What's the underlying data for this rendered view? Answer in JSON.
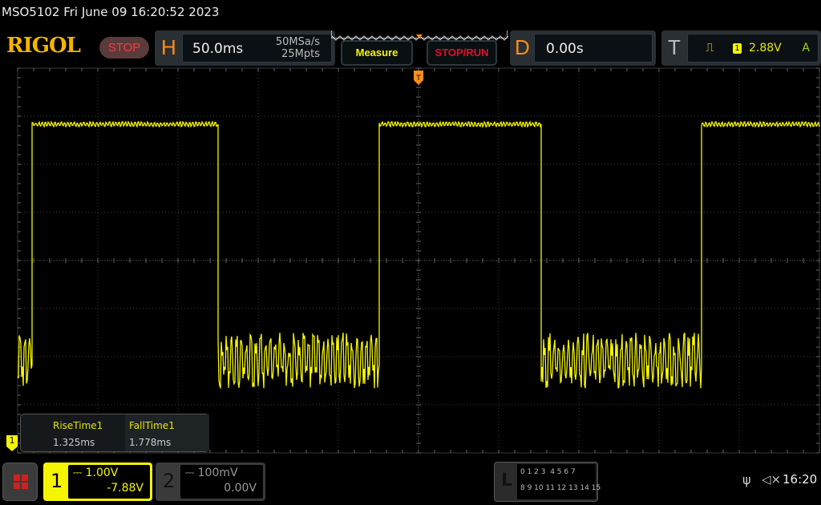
{
  "title": "MSO5102  Fri June 09 16:20:52 2023",
  "logo": "RIGOL",
  "run_state": "STOP",
  "horizontal": {
    "letter": "H",
    "timebase": "50.0ms",
    "sample_rate": "50MSa/s",
    "memory_depth": "25Mpts"
  },
  "buttons": {
    "measure": "Measure",
    "stop_run": "STOP/RUN"
  },
  "delay": {
    "letter": "D",
    "value": "0.00s"
  },
  "trigger": {
    "letter": "T",
    "source": "1",
    "level": "2.88V",
    "mode": "A"
  },
  "measurements": [
    {
      "label": "RiseTime1",
      "value": "1.325ms"
    },
    {
      "label": "FallTime1",
      "value": "1.778ms"
    }
  ],
  "channel1": {
    "number": "1",
    "scale": "1.00V",
    "offset": "-7.88V",
    "color": "#f5f500"
  },
  "channel2": {
    "number": "2",
    "scale": "100mV",
    "offset": "0.00V"
  },
  "ch1_marker": "1",
  "logic": {
    "letter": "L",
    "row1": "0 1 2 3  4 5 6 7",
    "row2": "8 9 10 11 12 13 14 15"
  },
  "status": {
    "clock": "16:20"
  }
}
